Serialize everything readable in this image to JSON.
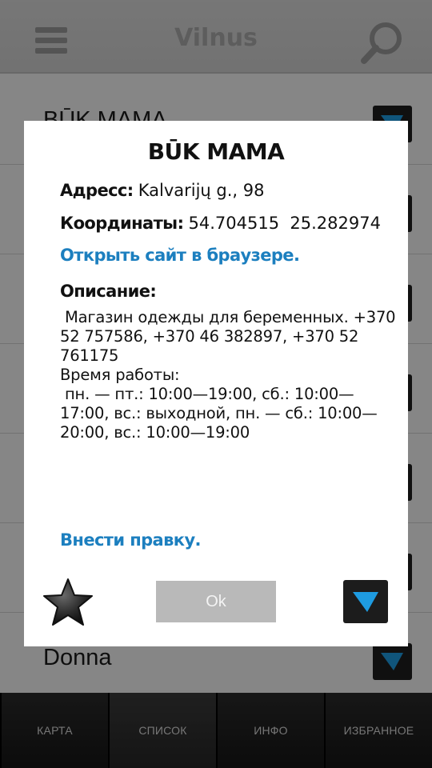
{
  "app": {
    "title": "Vilnus",
    "menu_icon": "hamburger-menu-icon",
    "search_icon": "search-icon"
  },
  "list": {
    "items": [
      {
        "name": "BŪK MAMA"
      },
      {
        "name": ""
      },
      {
        "name": ""
      },
      {
        "name": ""
      },
      {
        "name": ""
      },
      {
        "name": ""
      },
      {
        "name": "Donna"
      }
    ],
    "nav_icon": "navigate-arrow-icon"
  },
  "tabs": [
    {
      "label": "КАРТА"
    },
    {
      "label": "СПИСОК",
      "active": true
    },
    {
      "label": "ИНФО"
    },
    {
      "label": "ИЗБРАННОЕ"
    }
  ],
  "dialog": {
    "title": "BŪK MAMA",
    "address_label": "Адресс:",
    "address_value": "Kalvarijų g., 98",
    "coords_label": "Координаты:",
    "coords_value": "54.704515  25.282974",
    "open_site_link": "Открыть сайт в браузере.",
    "description_label": "Описание:",
    "description_text": " Магазин одежды для беременных. +370 52 757586, +370 46 382897, +370 52 761175\nВремя работы:\n пн. — пт.: 10:00—19:00, сб.: 10:00—17:00, вс.: выходной, пн. — сб.: 10:00—20:00, вс.: 10:00—19:00",
    "edit_link": "Внести правку.",
    "ok_label": "Ok",
    "favorite_icon": "star-icon",
    "navigate_icon": "navigate-arrow-icon"
  },
  "colors": {
    "link": "#1c7fbf",
    "nav_arrow": "#1e9be0",
    "ok_button": "#b9b9b9",
    "tabbar": "#111111"
  }
}
